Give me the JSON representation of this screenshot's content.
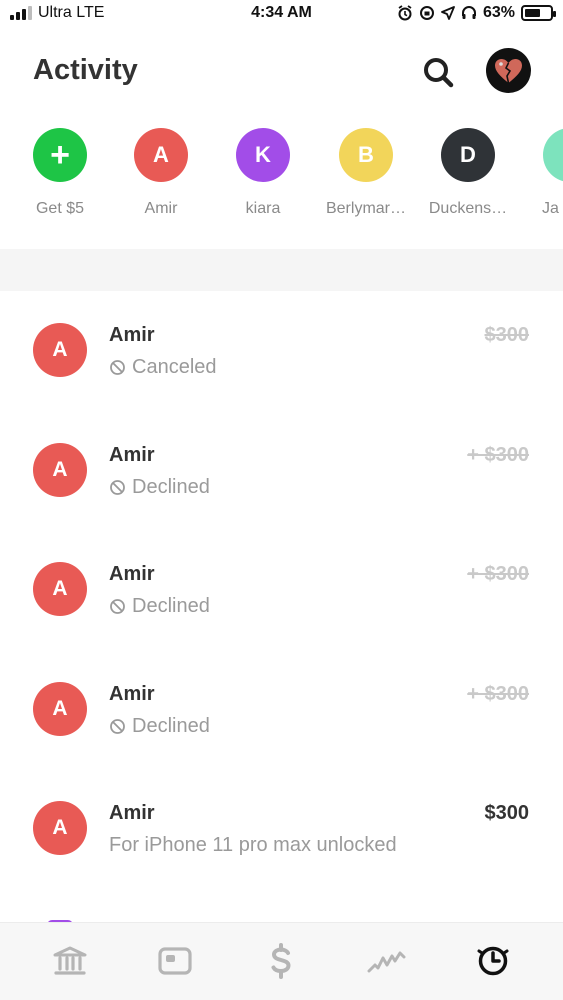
{
  "status_bar": {
    "carrier": "Ultra LTE",
    "time": "4:34 AM",
    "battery_percent": "63%",
    "battery_level": 0.63
  },
  "header": {
    "title": "Activity",
    "search_icon": "search-icon",
    "avatar_icon": "broken-heart-icon"
  },
  "people": [
    {
      "initial": "+",
      "name": "Get $5",
      "color": "#1ec546"
    },
    {
      "initial": "A",
      "name": "Amir",
      "color": "#e85a55"
    },
    {
      "initial": "K",
      "name": "kiara",
      "color": "#a24de8"
    },
    {
      "initial": "B",
      "name": "Berlymar…",
      "color": "#f2d55a"
    },
    {
      "initial": "D",
      "name": "Duckens…",
      "color": "#2f3337"
    },
    {
      "initial": "",
      "name": "Ja",
      "color": "#7de3bd"
    }
  ],
  "activities": [
    {
      "initial": "A",
      "name": "Amir",
      "status": "Canceled",
      "amount": "$300",
      "struck": true,
      "icon": "cancel-icon"
    },
    {
      "initial": "A",
      "name": "Amir",
      "status": "Declined",
      "amount": "+ $300",
      "struck": true,
      "icon": "cancel-icon"
    },
    {
      "initial": "A",
      "name": "Amir",
      "status": "Declined",
      "amount": "+ $300",
      "struck": true,
      "icon": "cancel-icon"
    },
    {
      "initial": "A",
      "name": "Amir",
      "status": "Declined",
      "amount": "+ $300",
      "struck": true,
      "icon": "cancel-icon"
    },
    {
      "initial": "A",
      "name": "Amir",
      "status": "For iPhone 11 pro max unlocked",
      "amount": "$300",
      "struck": false,
      "icon": ""
    }
  ],
  "tabs": [
    "bank-icon",
    "card-icon",
    "dollar-icon",
    "investing-icon",
    "activity-clock-icon"
  ],
  "colors": {
    "accent_red": "#e85a55",
    "green": "#1ec546",
    "purple": "#a24de8",
    "tab_inactive": "#b5b5b5",
    "tab_active": "#111111"
  }
}
